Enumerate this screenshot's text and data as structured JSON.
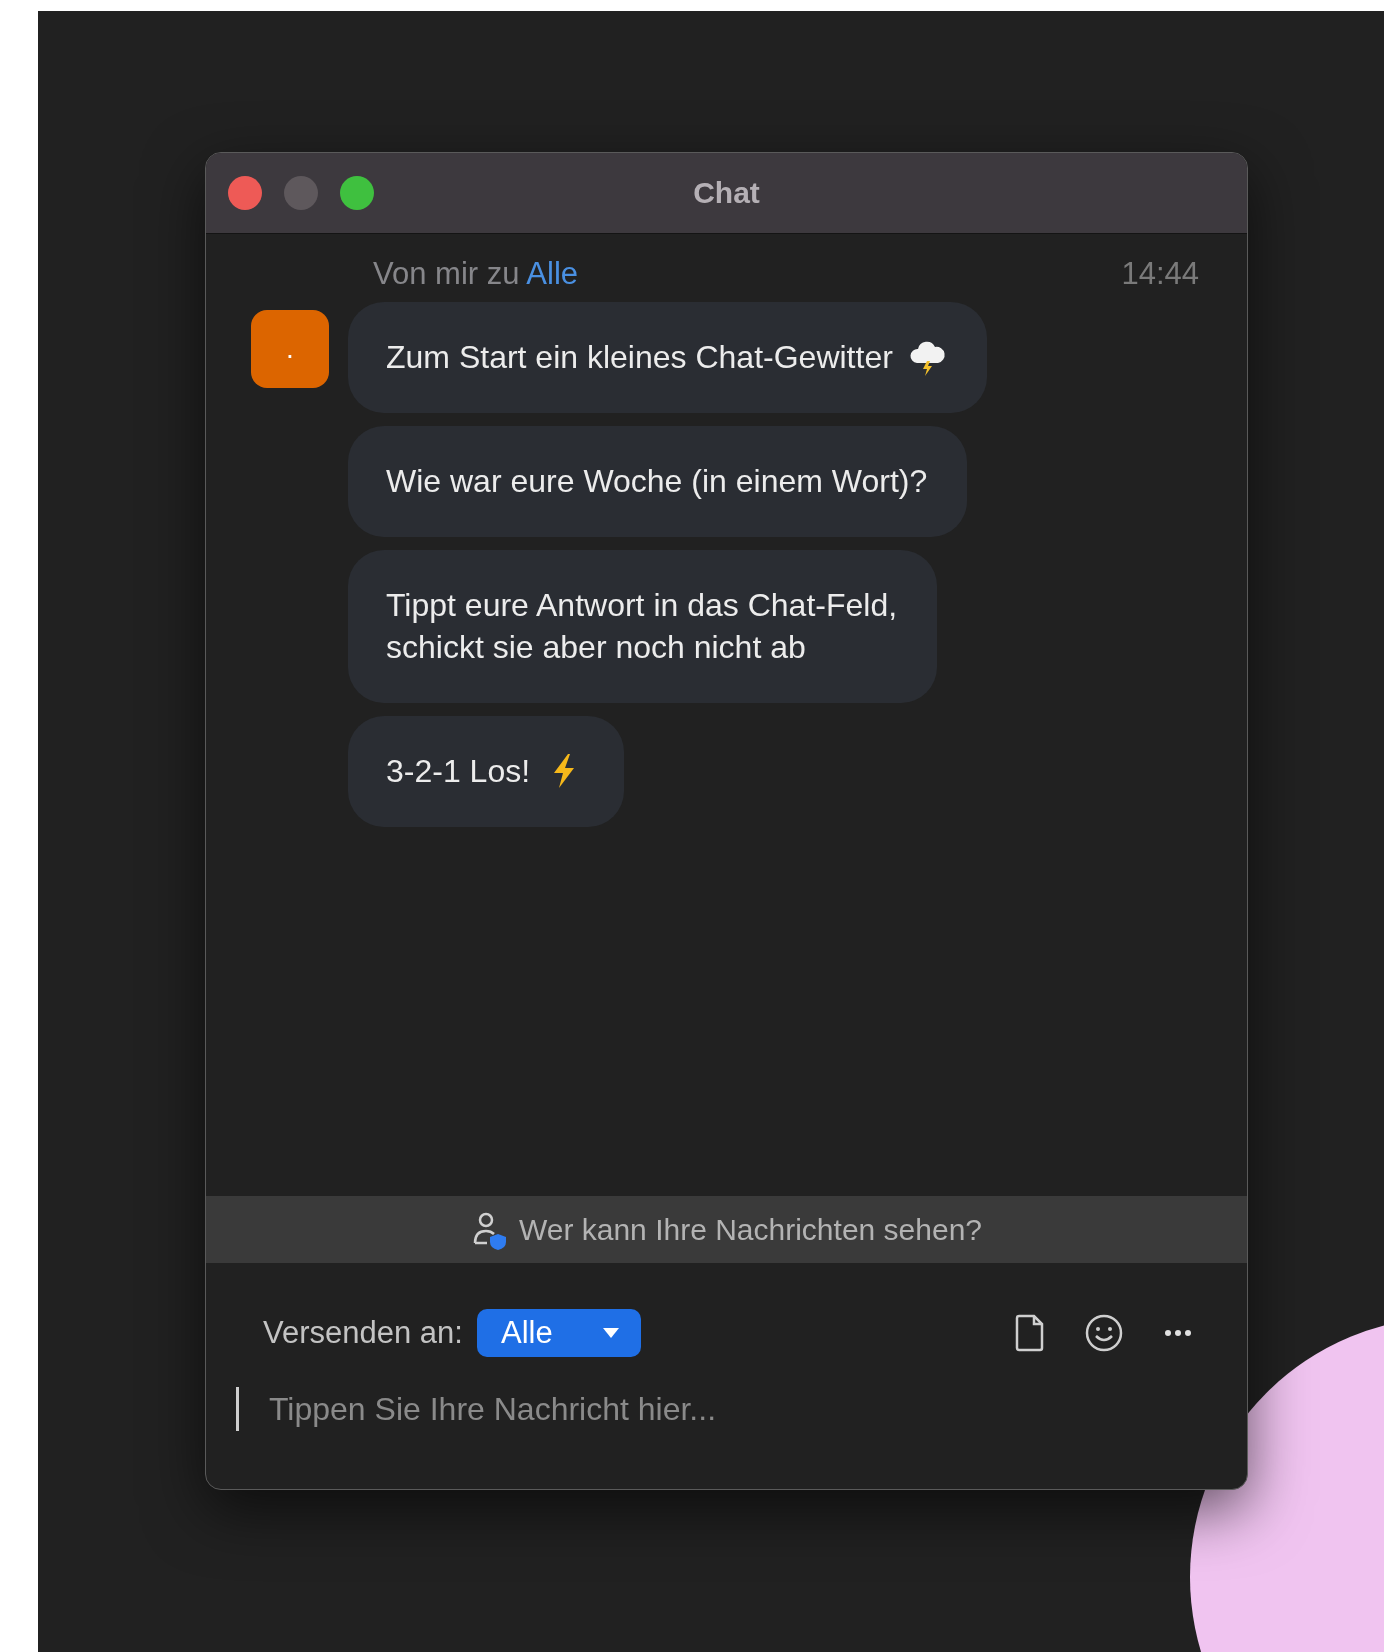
{
  "window": {
    "title": "Chat",
    "controls": [
      {
        "kind": "close"
      },
      {
        "kind": "minimize"
      },
      {
        "kind": "zoom"
      }
    ]
  },
  "header": {
    "sender": "Von mir zu",
    "recipient": "Alle",
    "time": "14:44"
  },
  "avatar": {
    "text": "."
  },
  "messages": [
    {
      "text": "Zum Start ein kleines Chat-Gewitter",
      "kind": "cloud-lightning"
    },
    {
      "text": "Wie war eure Woche (in einem Wort)?"
    },
    {
      "text": "Tippt eure Antwort in das Chat-Feld,\nschickt sie aber noch nicht ab"
    },
    {
      "text": "3-2-1 Los!",
      "kind": "lightning"
    }
  ],
  "privacy_banner": {
    "text": "Wer kann Ihre Nachrichten sehen?"
  },
  "composer": {
    "send_to_label": "Versenden an:",
    "recipient": "Alle",
    "tools": [
      {
        "kind": "file"
      },
      {
        "kind": "emoji"
      },
      {
        "kind": "more"
      }
    ],
    "placeholder": "Tippen Sie Ihre Nachricht hier..."
  }
}
